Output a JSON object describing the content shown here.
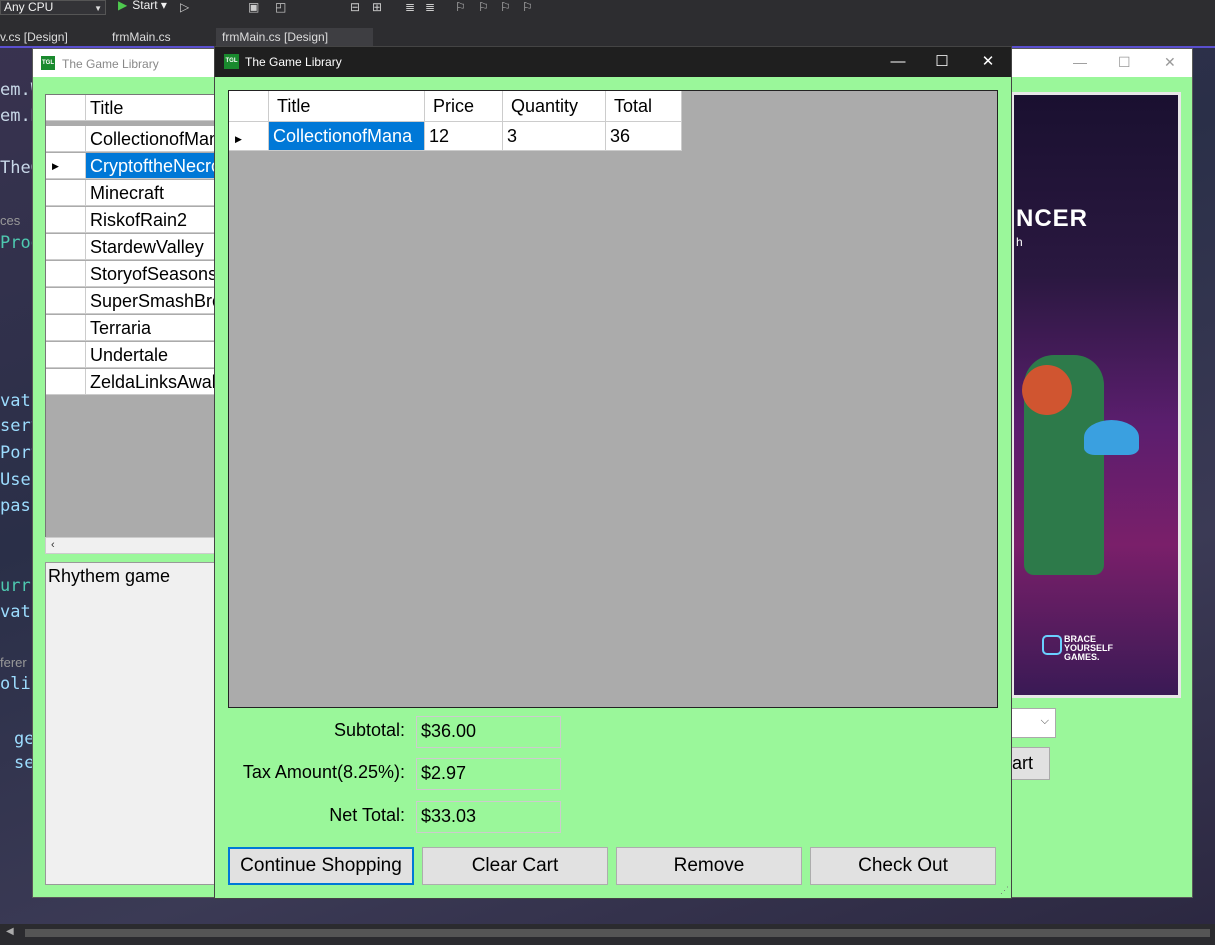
{
  "ide": {
    "platform_combo": "Any CPU",
    "start_label": "Start",
    "tabs": [
      "v.cs [Design]",
      "frmMain.cs",
      "frmMain.cs [Design]"
    ],
    "code_fragments": [
      "em.W",
      "em.D",
      "TheG",
      "ces",
      "Prog",
      "vat",
      "serv",
      "Port",
      "User",
      "pass",
      "urr",
      "vat",
      "ferer",
      "olic",
      "ge",
      "se"
    ]
  },
  "bg_window": {
    "title": "The Game Library",
    "grid": {
      "header": "Title",
      "rows": [
        "CollectionofMana",
        "CryptoftheNecrodancer",
        "Minecraft",
        "RiskofRain2",
        "StardewValley",
        "StoryofSeasons",
        "SuperSmashBros",
        "Terraria",
        "Undertale",
        "ZeldaLinksAwakening"
      ],
      "selected_index": 1
    },
    "description": "Rhythem game",
    "cover": {
      "title_fragment": "NCER",
      "subtitle_fragment": "h",
      "publisher": [
        "BRACE",
        "YOURSELF",
        "GAMES."
      ]
    },
    "add_to_cart_fragment": "art"
  },
  "cart_window": {
    "title": "The Game Library",
    "columns": [
      "Title",
      "Price",
      "Quantity",
      "Total"
    ],
    "rows": [
      {
        "title": "CollectionofMana",
        "price": "12",
        "quantity": "3",
        "total": "36"
      }
    ],
    "summary": {
      "subtotal_label": "Subtotal:",
      "subtotal": "$36.00",
      "tax_label": "Tax Amount(8.25%):",
      "tax": "$2.97",
      "net_label": "Net Total:",
      "net": "$33.03"
    },
    "buttons": {
      "continue": "Continue Shopping",
      "clear": "Clear Cart",
      "remove": "Remove",
      "checkout": "Check Out"
    }
  },
  "colors": {
    "form_bg": "#9af79a",
    "selection": "#0078d7",
    "grid_bg": "#ababab"
  }
}
